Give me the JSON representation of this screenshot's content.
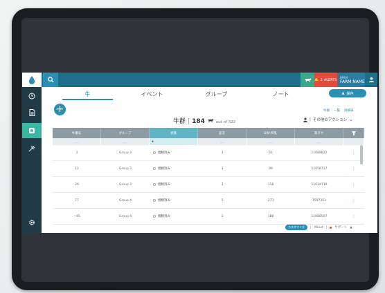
{
  "topbar": {
    "alert_count": "2",
    "alert_label": "ALERTS",
    "farm_caption": "FARM",
    "farm_name": "FARM NAME"
  },
  "tabs": [
    {
      "label": "牛",
      "active": true
    },
    {
      "label": "イベント",
      "active": false
    },
    {
      "label": "グループ",
      "active": false
    },
    {
      "label": "ノート",
      "active": false
    }
  ],
  "export_label": "保存",
  "view_links": [
    "牛群",
    "一覧",
    "詳細表"
  ],
  "herd": {
    "title": "牛群",
    "count": "184",
    "out_of": "out of 322"
  },
  "actions_label": "その他のアクション",
  "table": {
    "columns": [
      "牛番号",
      "グループ",
      "状態",
      "産次",
      "DIM 搾乳",
      "耳タグ"
    ],
    "highlighted_column": 2,
    "rows": [
      {
        "id": "3",
        "group": "Group 3",
        "status": "授精済み",
        "parity": "3",
        "dim": "61",
        "tag": "11089822"
      },
      {
        "id": "11",
        "group": "Group 3",
        "status": "授精済み",
        "parity": "3",
        "dim": "99",
        "tag": "11058717"
      },
      {
        "id": "29",
        "group": "Group 3",
        "status": "授精済み",
        "parity": "3",
        "dim": "118",
        "tag": "11034719"
      },
      {
        "id": "77",
        "group": "Group 4",
        "status": "授精済み",
        "parity": "5",
        "dim": "273",
        "tag": "7597351"
      },
      {
        "id": "~45",
        "group": "Group 4",
        "status": "授精済み",
        "parity": "2",
        "dim": "188",
        "tag": "11088507"
      }
    ]
  },
  "footer": {
    "pill": "カスタマイズ",
    "about": "About",
    "support": "サポート"
  },
  "colors": {
    "primary": "#2a8fb3",
    "topbar": "#1d6f8c",
    "sidebar": "#203c47",
    "accent_green": "#3bb6a3",
    "alert_red": "#e24a3b"
  }
}
